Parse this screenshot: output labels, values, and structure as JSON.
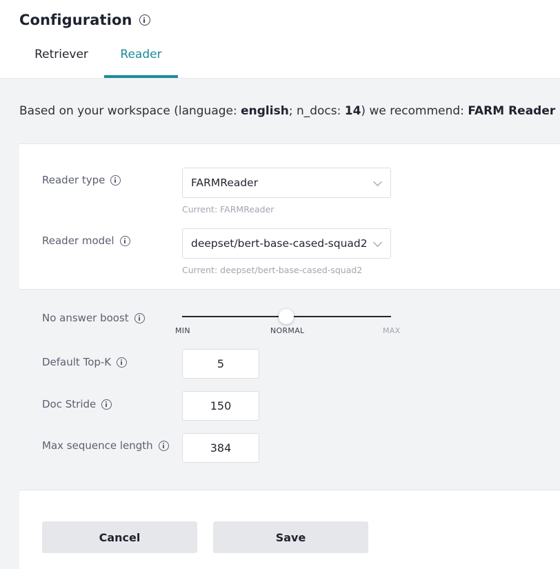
{
  "header": {
    "title": "Configuration",
    "tabs": [
      {
        "label": "Retriever",
        "active": false
      },
      {
        "label": "Reader",
        "active": true
      }
    ]
  },
  "recommendation": {
    "prefix": "Based on your workspace (language: ",
    "language": "english",
    "mid1": "; n_docs: ",
    "n_docs": "14",
    "mid2": ") we recommend: ",
    "recommended": "FARM Reader"
  },
  "reader": {
    "type_label": "Reader type",
    "type_value": "FARMReader",
    "type_current": "Current: FARMReader",
    "model_label": "Reader model",
    "model_value": "deepset/bert-base-cased-squad2",
    "model_current": "Current: deepset/bert-base-cased-squad2"
  },
  "params": {
    "no_answer_boost_label": "No answer boost",
    "slider": {
      "min_label": "MIN",
      "normal_label": "NORMAL",
      "max_label": "MAX",
      "position": 0.5
    },
    "top_k_label": "Default Top-K",
    "top_k_value": "5",
    "doc_stride_label": "Doc Stride",
    "doc_stride_value": "150",
    "max_seq_label": "Max sequence length",
    "max_seq_value": "384"
  },
  "actions": {
    "cancel_label": "Cancel",
    "save_label": "Save"
  },
  "colors": {
    "accent": "#1d8a99",
    "background": "#f2f3f5",
    "button": "#e6e7ea"
  }
}
